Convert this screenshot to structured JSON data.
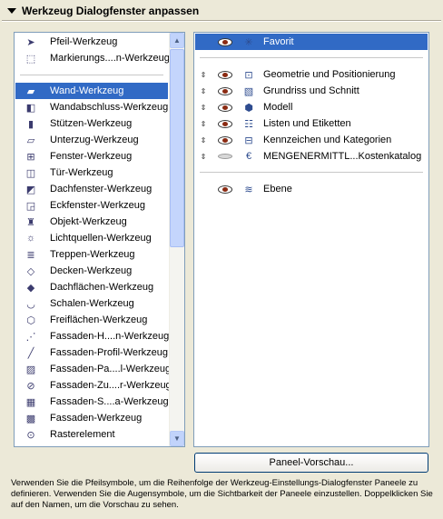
{
  "header": {
    "title": "Werkzeug Dialogfenster anpassen"
  },
  "left_list": {
    "top_items": [
      {
        "label": "Pfeil-Werkzeug",
        "icon": "arrow-pointer-icon"
      },
      {
        "label": "Markierungs....n-Werkzeug",
        "icon": "marquee-icon"
      }
    ],
    "items": [
      {
        "label": "Wand-Werkzeug",
        "icon": "wall-icon",
        "selected": true
      },
      {
        "label": "Wandabschluss-Werkzeug",
        "icon": "wall-end-icon"
      },
      {
        "label": "Stützen-Werkzeug",
        "icon": "column-icon"
      },
      {
        "label": "Unterzug-Werkzeug",
        "icon": "beam-icon"
      },
      {
        "label": "Fenster-Werkzeug",
        "icon": "window-icon"
      },
      {
        "label": "Tür-Werkzeug",
        "icon": "door-icon"
      },
      {
        "label": "Dachfenster-Werkzeug",
        "icon": "skylight-icon"
      },
      {
        "label": "Eckfenster-Werkzeug",
        "icon": "corner-window-icon"
      },
      {
        "label": "Objekt-Werkzeug",
        "icon": "object-icon"
      },
      {
        "label": "Lichtquellen-Werkzeug",
        "icon": "lamp-icon"
      },
      {
        "label": "Treppen-Werkzeug",
        "icon": "stair-icon"
      },
      {
        "label": "Decken-Werkzeug",
        "icon": "slab-icon"
      },
      {
        "label": "Dachflächen-Werkzeug",
        "icon": "roof-icon"
      },
      {
        "label": "Schalen-Werkzeug",
        "icon": "shell-icon"
      },
      {
        "label": "Freiflächen-Werkzeug",
        "icon": "mesh-icon"
      },
      {
        "label": "Fassaden-H....n-Werkzeug",
        "icon": "curtain-wall-icon"
      },
      {
        "label": "Fassaden-Profil-Werkzeug",
        "icon": "curtain-frame-icon"
      },
      {
        "label": "Fassaden-Pa....l-Werkzeug",
        "icon": "curtain-panel-icon"
      },
      {
        "label": "Fassaden-Zu....r-Werkzeug",
        "icon": "curtain-accessory-icon"
      },
      {
        "label": "Fassaden-S....a-Werkzeug",
        "icon": "curtain-scheme-icon"
      },
      {
        "label": "Fassaden-Werkzeug",
        "icon": "curtain-grid-icon"
      },
      {
        "label": "Rasterelement",
        "icon": "grid-element-icon"
      }
    ]
  },
  "right_list": {
    "favorit": {
      "label": "Favorit",
      "icon": "favorite-star-icon",
      "selected": true
    },
    "panels": [
      {
        "label": "Geometrie und Positionierung",
        "icon": "geometry-icon",
        "visible": true
      },
      {
        "label": "Grundriss und Schnitt",
        "icon": "floorplan-icon",
        "visible": true
      },
      {
        "label": "Modell",
        "icon": "model-icon",
        "visible": true
      },
      {
        "label": "Listen und Etiketten",
        "icon": "listing-icon",
        "visible": true
      },
      {
        "label": "Kennzeichen und Kategorien",
        "icon": "tags-icon",
        "visible": true
      },
      {
        "label": "MENGENERMITTL...Kostenkatalog",
        "icon": "cost-catalog-icon",
        "visible": false
      }
    ],
    "bottom": {
      "label": "Ebene",
      "icon": "layers-icon"
    }
  },
  "preview_button": {
    "label": "Paneel-Vorschau..."
  },
  "help_text": "Verwenden Sie die Pfeilsymbole, um die Reihenfolge der Werkzeug-Einstellungs-Dialogfenster Paneele zu definieren. Verwenden Sie die Augensymbole, um die Sichtbarkeit der Paneele einzustellen. Doppelklicken Sie auf den Namen, um die Vorschau zu sehen."
}
